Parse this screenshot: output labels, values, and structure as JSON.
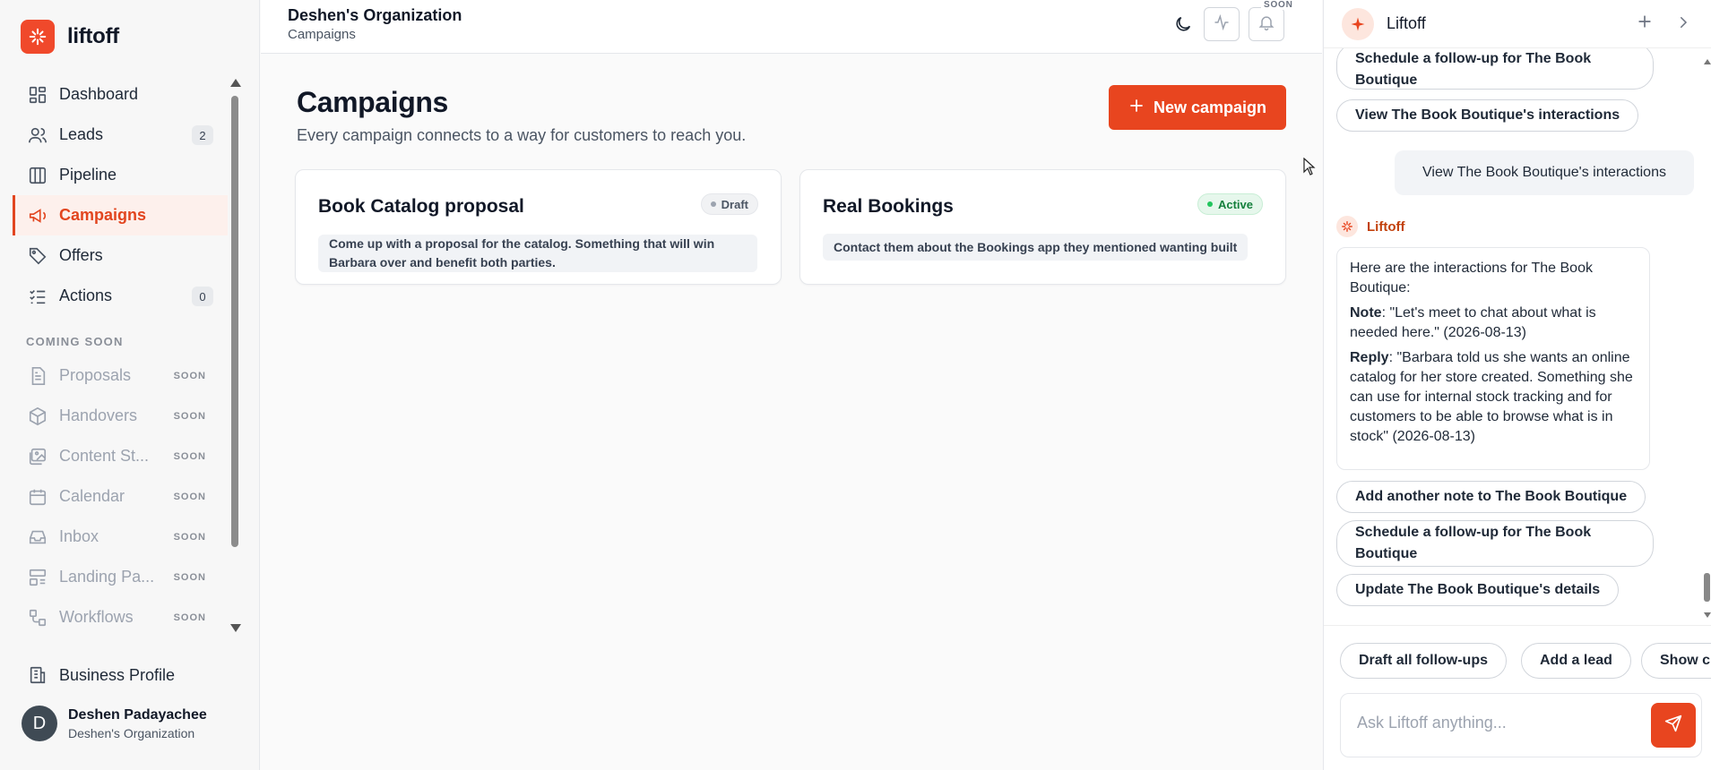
{
  "brand": {
    "name": "liftoff",
    "accent": "#e8451f"
  },
  "sidebar": {
    "items": [
      {
        "label": "Dashboard",
        "icon": "dashboard-icon"
      },
      {
        "label": "Leads",
        "icon": "users-icon",
        "badge": "2"
      },
      {
        "label": "Pipeline",
        "icon": "pipeline-icon"
      },
      {
        "label": "Campaigns",
        "icon": "megaphone-icon",
        "active": true
      },
      {
        "label": "Offers",
        "icon": "tag-icon"
      },
      {
        "label": "Actions",
        "icon": "checklist-icon",
        "badge": "0"
      }
    ],
    "section_label": "COMING SOON",
    "soon_items": [
      {
        "label": "Proposals",
        "tag": "SOON",
        "icon": "document-icon"
      },
      {
        "label": "Handovers",
        "tag": "SOON",
        "icon": "package-icon"
      },
      {
        "label": "Content St...",
        "tag": "SOON",
        "icon": "image-icon"
      },
      {
        "label": "Calendar",
        "tag": "SOON",
        "icon": "calendar-icon"
      },
      {
        "label": "Inbox",
        "tag": "SOON",
        "icon": "inbox-icon"
      },
      {
        "label": "Landing Pa...",
        "tag": "SOON",
        "icon": "layout-icon"
      },
      {
        "label": "Workflows",
        "tag": "SOON",
        "icon": "workflow-icon"
      }
    ],
    "business_profile": "Business Profile",
    "user": {
      "initial": "D",
      "name": "Deshen Padayachee",
      "org": "Deshen's Organization"
    }
  },
  "topbar": {
    "org": "Deshen's Organization",
    "crumb": "Campaigns",
    "soon_label": "SOON"
  },
  "main": {
    "title": "Campaigns",
    "subtitle": "Every campaign connects to a way for customers to reach you.",
    "new_button": "New campaign",
    "cards": [
      {
        "title": "Book Catalog proposal",
        "status": "Draft",
        "desc_line1": "Come up with a proposal for the catalog. Something that will win",
        "desc_line2": "Barbara over and benefit both parties."
      },
      {
        "title": "Real Bookings",
        "status": "Active",
        "desc_line1": "Contact them about the Bookings app they mentioned wanting built"
      }
    ]
  },
  "chat": {
    "title": "Liftoff",
    "top_pill_1": "Schedule a follow-up for The Book Boutique",
    "top_pill_2": "View The Book Boutique's interactions",
    "user_message": "View The Book Boutique's interactions",
    "bot_name": "Liftoff",
    "bot_intro": "Here are the interactions for The Book Boutique:",
    "note_label": "Note",
    "note_text": ": \"Let's meet to chat about what is needed here.\" (2026-08-13)",
    "reply_label": "Reply",
    "reply_text": ": \"Barbara told us she wants an online catalog for her store created. Something she can use for internal stock tracking and for customers to be able to browse what is in stock\" (2026-08-13)",
    "suggestions": [
      "Add another note to The Book Boutique",
      "Schedule a follow-up for The Book Boutique",
      "Update The Book Boutique's details"
    ],
    "quick_actions": [
      "Draft all follow-ups",
      "Add a lead",
      "Show c"
    ],
    "input_placeholder": "Ask Liftoff anything..."
  }
}
